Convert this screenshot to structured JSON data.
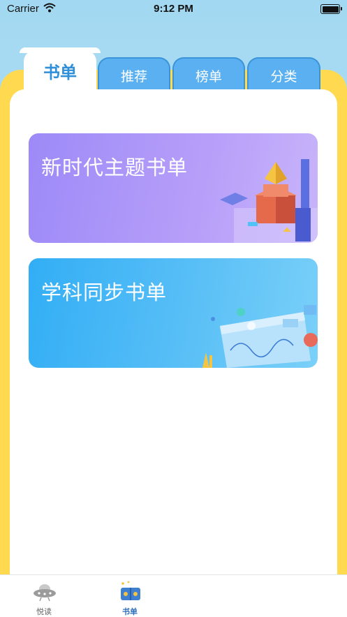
{
  "status_bar": {
    "carrier": "Carrier",
    "time": "9:12 PM"
  },
  "tabs": [
    {
      "label": "书单",
      "active": true
    },
    {
      "label": "推荐",
      "active": false
    },
    {
      "label": "榜单",
      "active": false
    },
    {
      "label": "分类",
      "active": false
    }
  ],
  "cards": [
    {
      "title": "新时代主题书单"
    },
    {
      "title": "学科同步书单"
    }
  ],
  "tab_bar": [
    {
      "label": "悦读",
      "icon": "ufo-icon",
      "active": false
    },
    {
      "label": "书单",
      "icon": "book-icon",
      "active": true
    }
  ],
  "colors": {
    "accent": "#2f8fd8",
    "frame": "#ffd94f",
    "tab_bg": "#5ab0f0"
  }
}
